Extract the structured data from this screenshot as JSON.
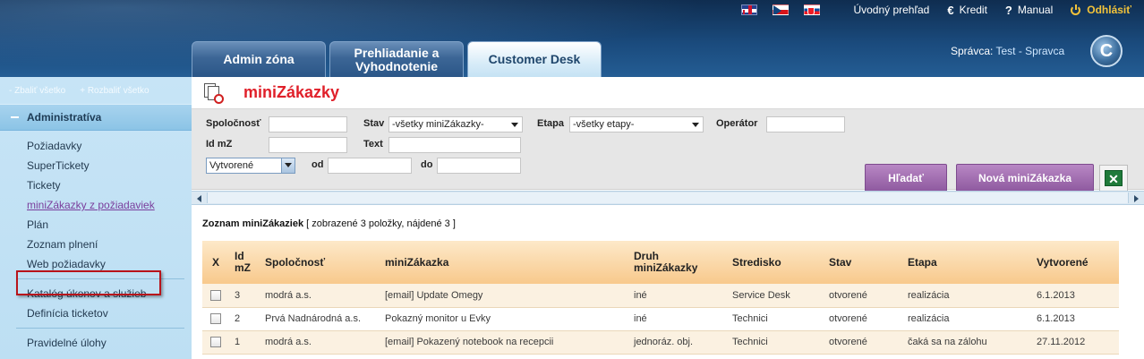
{
  "header": {
    "flags": [
      "uk-flag-icon",
      "cz-flag-icon",
      "sk-flag-icon"
    ],
    "links": {
      "home": "Úvodný prehľad",
      "credit": "Kredit",
      "manual": "Manual",
      "logout": "Odhlásiť"
    },
    "tabs": [
      {
        "label": "Admin zóna",
        "active": false
      },
      {
        "label": "Prehliadanie a Vyhodnotenie",
        "active": false
      },
      {
        "label": "Customer Desk",
        "active": true
      }
    ],
    "admin_label": "Správca:",
    "admin_name": "Test - Spravca",
    "logo_letter": "C"
  },
  "sidebar": {
    "collapse_all": "- Zbaliť všetko",
    "expand_all": "+ Rozbaliť všetko",
    "section": "Administratíva",
    "group1": [
      "Požiadavky",
      "SuperTickety",
      "Tickety",
      "miniZákazky z požiadaviek",
      "Plán",
      "Zoznam plnení",
      "Web požiadavky"
    ],
    "group2": [
      "Katalóg úkonov a služieb",
      "Definícia ticketov"
    ],
    "group3": [
      "Pravidelné úlohy"
    ]
  },
  "page": {
    "title": "miniZákazky"
  },
  "filter": {
    "company_label": "Spoločnosť",
    "company_value": "",
    "status_label": "Stav",
    "status_value": "-všetky miniZákazky-",
    "stage_label": "Etapa",
    "stage_value": "-všetky etapy-",
    "operator_label": "Operátor",
    "operator_value": "",
    "idmz_label": "Id mZ",
    "idmz_value": "",
    "text_label": "Text",
    "text_value": "",
    "date_type_value": "Vytvorené",
    "from_label": "od",
    "from_value": "",
    "to_label": "do",
    "to_value": "",
    "search_button": "Hľadať",
    "new_button": "Nová miniZákazka",
    "excel_icon": "excel-icon"
  },
  "list": {
    "title": "Zoznam miniZákaziek",
    "meta": "[ zobrazené 3 položky, nájdené 3 ]",
    "columns": [
      "X",
      "Id mZ",
      "Spoločnosť",
      "miniZákazka",
      "Druh miniZákazky",
      "Stredisko",
      "Stav",
      "Etapa",
      "Vytvorené"
    ],
    "rows": [
      {
        "id": "3",
        "company": "modrá a.s.",
        "name": "[email] Update Omegy",
        "type": "iné",
        "center": "Service Desk",
        "status": "otvorené",
        "stage": "realizácia",
        "created": "6.1.2013"
      },
      {
        "id": "2",
        "company": "Prvá Nadnárodná a.s.",
        "name": "Pokazný monitor u Evky",
        "type": "iné",
        "center": "Technici",
        "status": "otvorené",
        "stage": "realizácia",
        "created": "6.1.2013"
      },
      {
        "id": "1",
        "company": "modrá a.s.",
        "name": "[email] Pokazený notebook na recepcii",
        "type": "jednoráz. obj.",
        "center": "Technici",
        "status": "otvorené",
        "stage": "čaká sa na zálohu",
        "created": "27.11.2012"
      }
    ]
  }
}
